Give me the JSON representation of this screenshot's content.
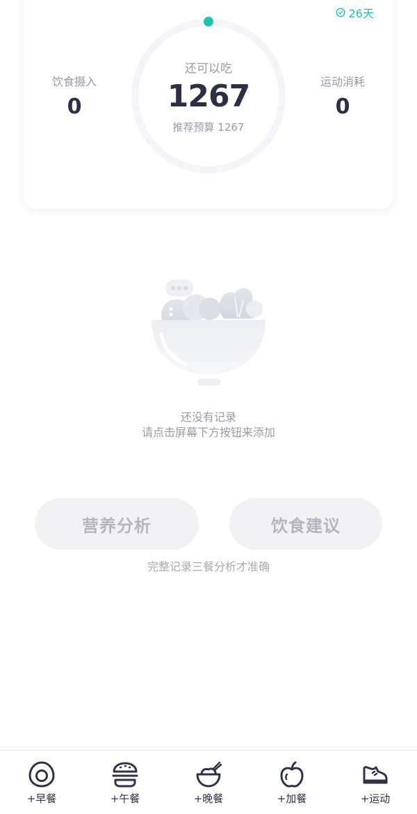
{
  "summary": {
    "streak_days": "26天",
    "remaining_label": "还可以吃",
    "remaining_value": "1267",
    "budget_text": "推荐预算 1267",
    "intake_label": "饮食摄入",
    "intake_value": "0",
    "burn_label": "运动消耗",
    "burn_value": "0",
    "accent_color": "#1fc2b0",
    "ring_progress": 0
  },
  "empty_state": {
    "title": "还没有记录",
    "subtitle": "请点击屏幕下方按钮来添加",
    "illustration": "salad-bowl-icon"
  },
  "analysis": {
    "nutrition_label": "营养分析",
    "diet_advice_label": "饮食建议",
    "hint": "完整记录三餐分析才准确"
  },
  "bottom_bar": {
    "items": [
      {
        "label": "+早餐",
        "icon": "egg-icon"
      },
      {
        "label": "+午餐",
        "icon": "burger-icon"
      },
      {
        "label": "+晚餐",
        "icon": "rice-bowl-icon"
      },
      {
        "label": "+加餐",
        "icon": "apple-icon"
      },
      {
        "label": "+运动",
        "icon": "sneaker-icon"
      }
    ]
  }
}
